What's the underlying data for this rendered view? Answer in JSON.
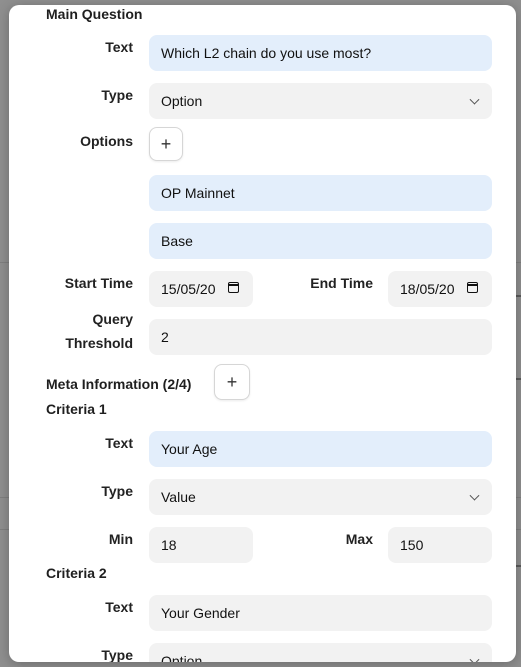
{
  "main_question": {
    "title": "Main Question",
    "text_label": "Text",
    "text_value": "Which L2 chain do you use most?",
    "type_label": "Type",
    "type_value": "Option",
    "options_label": "Options",
    "add_option": "+",
    "options": [
      "OP Mainnet",
      "Base"
    ],
    "start_time_label": "Start Time",
    "start_time_value": "15/05/20",
    "end_time_label": "End Time",
    "end_time_value": "18/05/20",
    "query_label_line1": "Query",
    "query_label_line2": "Threshold",
    "query_value": "2"
  },
  "meta": {
    "title": "Meta Information (2/4)",
    "add_criteria": "+"
  },
  "criteria": [
    {
      "title": "Criteria 1",
      "text_label": "Text",
      "text_value": "Your Age",
      "type_label": "Type",
      "type_value": "Value",
      "min_label": "Min",
      "min_value": "18",
      "max_label": "Max",
      "max_value": "150"
    },
    {
      "title": "Criteria 2",
      "text_label": "Text",
      "text_value": "Your Gender",
      "type_label": "Type",
      "type_value": "Option"
    }
  ],
  "colors": {
    "field_bg": "#f2f2f2",
    "field_focus_bg": "#e3eefb",
    "overlay": "#8c8c8c"
  },
  "icons": [
    "plus-icon",
    "chevron-down-icon",
    "calendar-icon"
  ]
}
